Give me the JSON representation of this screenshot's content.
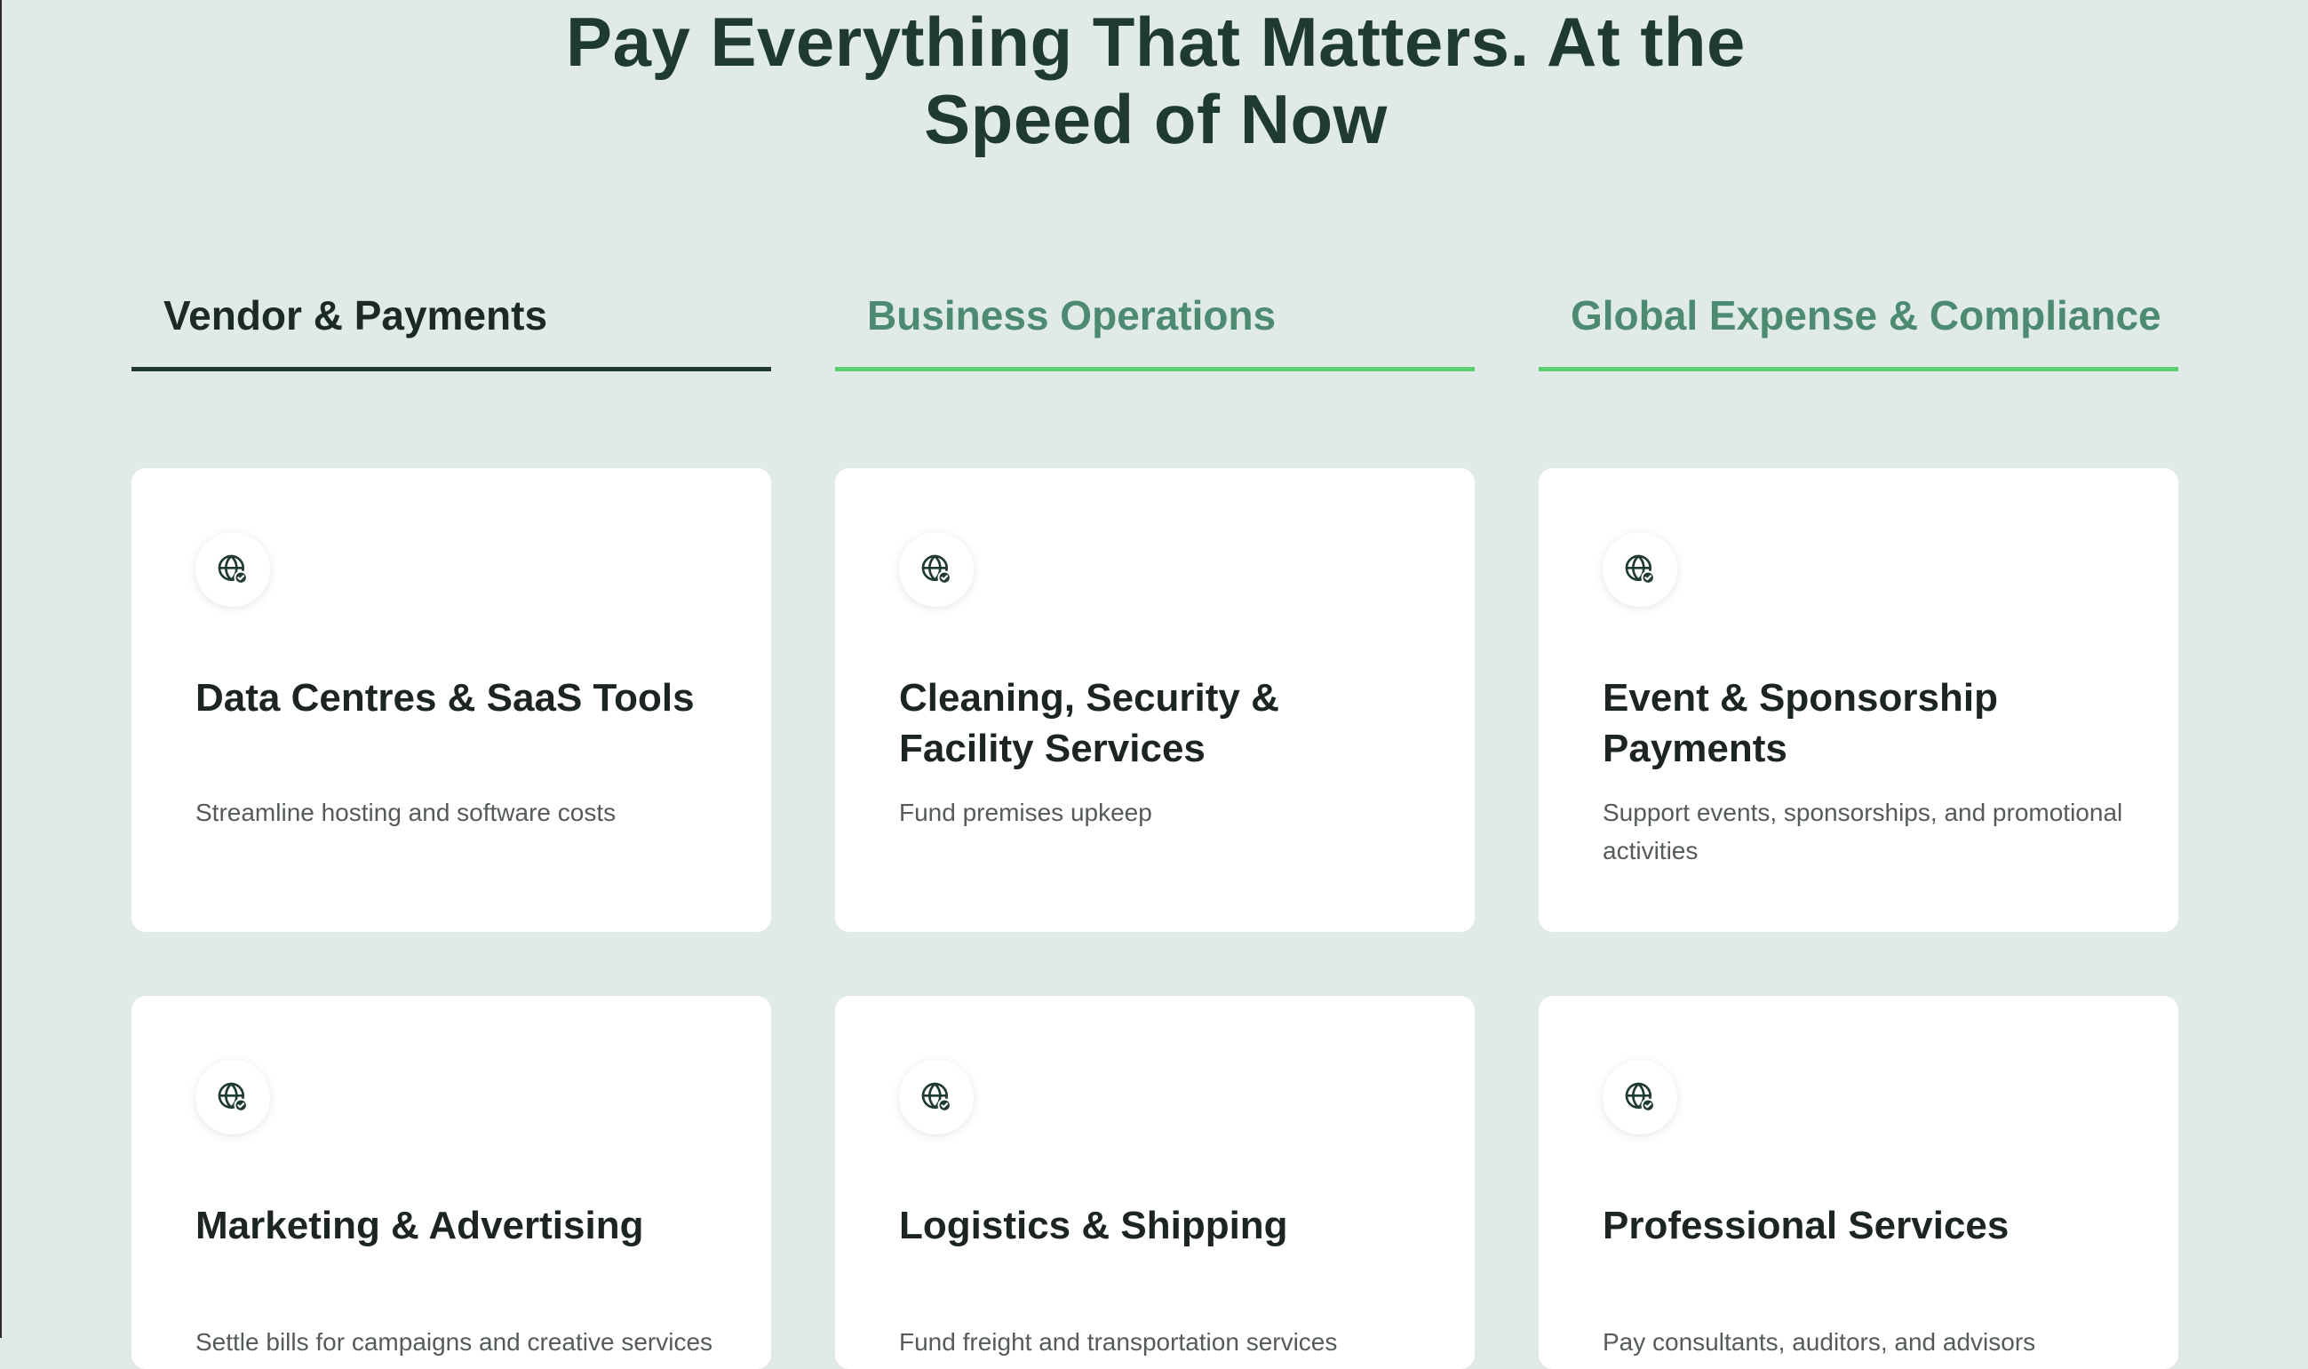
{
  "hero": {
    "title_line1": "Pay Everything That Matters. At the",
    "title_line2": "Speed of Now"
  },
  "tabs": [
    {
      "label": "Vendor & Payments",
      "active": true
    },
    {
      "label": "Business Operations",
      "active": false
    },
    {
      "label": "Global Expense & Compliance",
      "active": false
    }
  ],
  "cards": [
    {
      "icon": "globe-check-icon",
      "title": "Data Centres & SaaS Tools",
      "description": "Streamline hosting and software costs"
    },
    {
      "icon": "globe-check-icon",
      "title": "Cleaning, Security & Facility Services",
      "description": "Fund premises upkeep"
    },
    {
      "icon": "globe-check-icon",
      "title": "Event & Sponsorship Payments",
      "description": "Support events, sponsorships, and promotional activities"
    },
    {
      "icon": "globe-check-icon",
      "title": "Marketing & Advertising",
      "description": "Settle bills for campaigns and creative services"
    },
    {
      "icon": "globe-check-icon",
      "title": "Logistics & Shipping",
      "description": "Fund freight and transportation services"
    },
    {
      "icon": "globe-check-icon",
      "title": "Professional Services",
      "description": "Pay consultants, auditors, and advisors"
    }
  ],
  "colors": {
    "background": "#e0eae7",
    "heading": "#1f3a33",
    "tab_active_underline": "#1f3a33",
    "tab_inactive_text": "#4d8a72",
    "tab_inactive_underline": "#5ccf73",
    "card_background": "#ffffff"
  }
}
